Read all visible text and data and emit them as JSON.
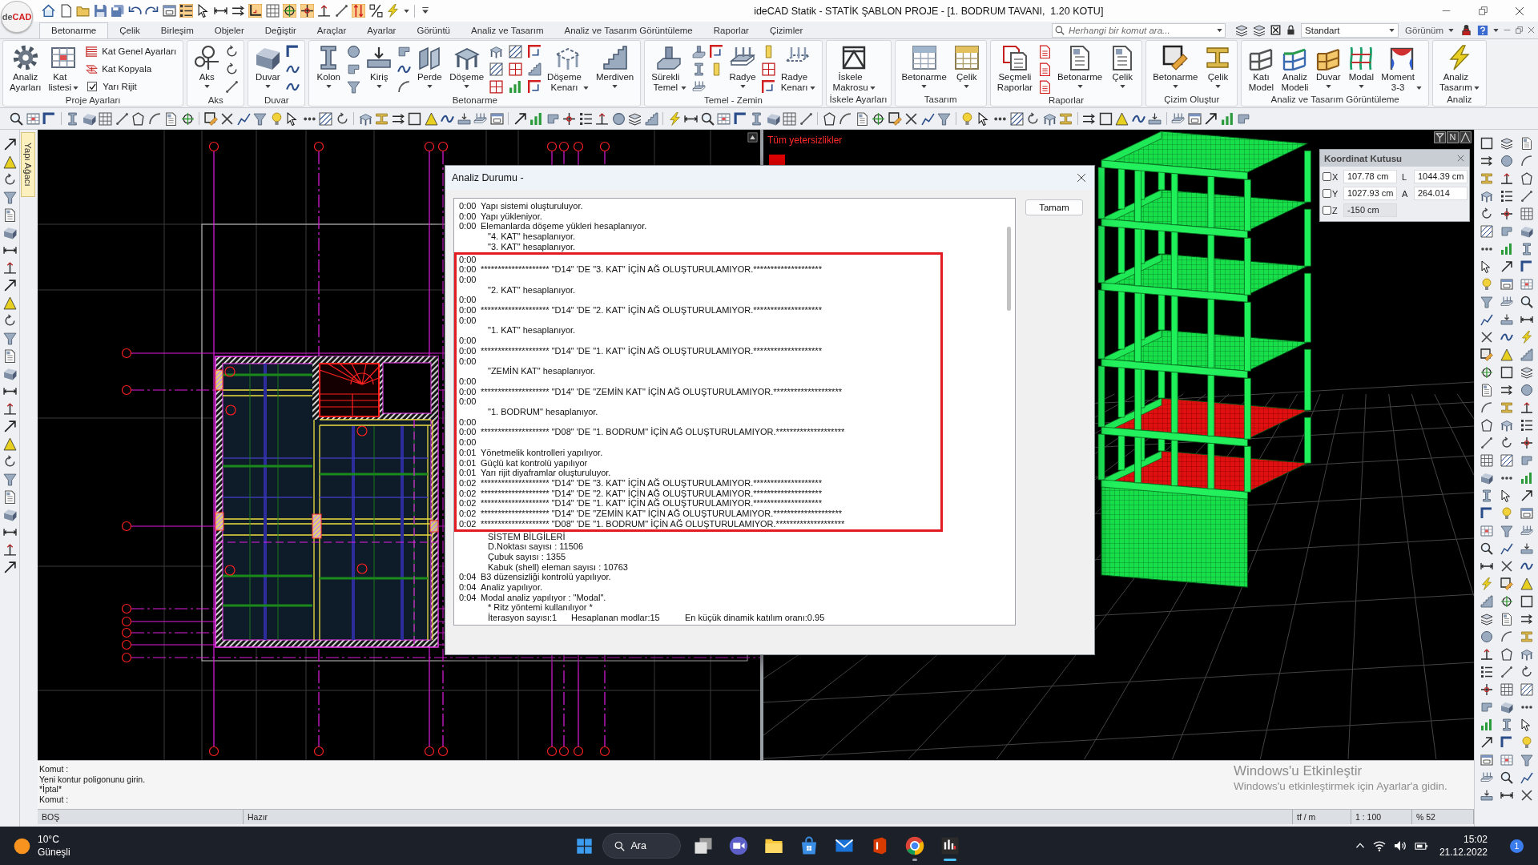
{
  "window": {
    "logo": "de**CAD**",
    "title": "ideCAD Statik - STATİK ŞABLON PROJE - [1. BODRUM TAVANI,  1.20 KOTU]"
  },
  "quick_access": [
    {
      "on": false
    },
    {
      "on": false
    },
    {
      "on": false
    },
    {
      "on": false
    },
    {
      "on": false
    },
    {
      "on": false
    },
    {
      "on": false
    },
    {
      "on": false
    },
    {
      "on": true
    },
    {
      "on": false
    },
    {
      "on": false
    },
    {
      "on": false
    },
    {
      "on": true
    },
    {
      "on": false
    },
    {
      "on": true
    },
    {
      "on": true
    },
    {
      "on": false
    },
    {
      "on": false
    },
    {
      "on": true
    },
    {
      "on": false
    },
    {
      "on": false
    }
  ],
  "tabs": [
    {
      "label": "Betonarme",
      "selected": true
    },
    {
      "label": "Çelik",
      "selected": false
    },
    {
      "label": "Birleşim",
      "selected": false
    },
    {
      "label": "Objeler",
      "selected": false
    },
    {
      "label": "Değiştir",
      "selected": false
    },
    {
      "label": "Araçlar",
      "selected": false
    },
    {
      "label": "Ayarlar",
      "selected": false
    },
    {
      "label": "Görüntü",
      "selected": false
    },
    {
      "label": "Analiz ve Tasarım",
      "selected": false
    },
    {
      "label": "Analiz ve Tasarım Görüntüleme",
      "selected": false
    },
    {
      "label": "Raporlar",
      "selected": false
    },
    {
      "label": "Çizimler",
      "selected": false
    }
  ],
  "search": {
    "placeholder": "Herhangi bir komut ara..."
  },
  "style_dropdown": {
    "value": "Standart"
  },
  "view_menu": {
    "label": "Görünüm"
  },
  "ribbon_groups": [
    {
      "label": "Proje Ayarları",
      "items": [
        {
          "kind": "large",
          "label": "Analiz Ayarları",
          "dropdown": false
        },
        {
          "kind": "large",
          "label": "Kat listesi",
          "dropdown": true
        },
        {
          "kind": "stack",
          "entries": [
            {
              "kind": "button",
              "label": "Kat Genel Ayarları"
            },
            {
              "kind": "button",
              "label": "Kat Kopyala"
            },
            {
              "kind": "checkbox",
              "label": "Yarı Rijit",
              "checked": true
            }
          ]
        }
      ]
    },
    {
      "label": "Aks",
      "items": [
        {
          "kind": "large",
          "label": "Aks",
          "dropdown": true
        },
        {
          "kind": "icons"
        }
      ]
    },
    {
      "label": "Duvar",
      "items": [
        {
          "kind": "large",
          "label": "Duvar",
          "dropdown": true
        },
        {
          "kind": "icons"
        }
      ]
    },
    {
      "label": "Betonarme",
      "items": [
        {
          "kind": "large",
          "label": "Kolon",
          "dropdown": true
        },
        {
          "kind": "icons"
        },
        {
          "kind": "large",
          "label": "Kiriş",
          "dropdown": true
        },
        {
          "kind": "icons"
        },
        {
          "kind": "large",
          "label": "Perde",
          "dropdown": true
        },
        {
          "kind": "large",
          "label": "Döşeme",
          "dropdown": true
        },
        {
          "kind": "icons"
        },
        {
          "kind": "large",
          "label": "Döşeme Kenarı",
          "dropdown": true
        },
        {
          "kind": "large",
          "label": "Merdiven",
          "dropdown": true
        }
      ]
    },
    {
      "label": "Temel - Zemin",
      "items": [
        {
          "kind": "large",
          "label": "Sürekli Temel",
          "dropdown": true
        },
        {
          "kind": "icons"
        },
        {
          "kind": "icons"
        },
        {
          "kind": "large",
          "label": "Radye",
          "dropdown": true
        },
        {
          "kind": "icons"
        },
        {
          "kind": "large",
          "label": "Radye Kenarı",
          "dropdown": true
        }
      ]
    },
    {
      "label": "İskele Ayarları",
      "items": [
        {
          "kind": "large",
          "label": "İskele Makrosu",
          "dropdown": true
        }
      ]
    },
    {
      "label": "Tasarım",
      "items": [
        {
          "kind": "large",
          "label": "Betonarme",
          "dropdown": true
        },
        {
          "kind": "large",
          "label": "Çelik",
          "dropdown": true
        }
      ]
    },
    {
      "label": "Raporlar",
      "items": [
        {
          "kind": "large",
          "label": "Seçmeli Raporlar",
          "dropdown": false
        },
        {
          "kind": "icons"
        },
        {
          "kind": "large",
          "label": "Betonarme",
          "dropdown": true
        },
        {
          "kind": "large",
          "label": "Çelik",
          "dropdown": true
        }
      ]
    },
    {
      "label": "Çizim Oluştur",
      "items": [
        {
          "kind": "large",
          "label": "Betonarme",
          "dropdown": true
        },
        {
          "kind": "large",
          "label": "Çelik",
          "dropdown": true
        }
      ]
    },
    {
      "label": "Analiz ve Tasarım Görüntüleme",
      "items": [
        {
          "kind": "large",
          "label": "Katı Model",
          "dropdown": false
        },
        {
          "kind": "large",
          "label": "Analiz Modeli",
          "dropdown": false
        },
        {
          "kind": "large",
          "label": "Duvar",
          "dropdown": true
        },
        {
          "kind": "large",
          "label": "Modal",
          "dropdown": true
        },
        {
          "kind": "large",
          "label": "Moment 3-3",
          "dropdown": true
        }
      ]
    },
    {
      "label": "Analiz",
      "items": [
        {
          "kind": "large",
          "label": "Analiz Tasarım",
          "dropdown": true
        }
      ]
    }
  ],
  "structure_tree_tab": {
    "label": "Yapı Ağacı"
  },
  "viewport_3d": {
    "message": "Tüm yetersizlikler",
    "view_label": "N"
  },
  "coordinate_box": {
    "title": "Koordinat Kutusu",
    "rows": [
      {
        "axis": "X",
        "checked": false,
        "value": "107.78 cm",
        "disabled": false,
        "second_label": "L",
        "second_value": "1044.39 cm"
      },
      {
        "axis": "Y",
        "checked": false,
        "value": "1027.93 cm",
        "disabled": false,
        "second_label": "A",
        "second_value": "264.014"
      },
      {
        "axis": "Z",
        "checked": false,
        "value": "-150 cm",
        "disabled": true
      }
    ]
  },
  "dialog": {
    "title": "Analiz Durumu -",
    "ok_button": "Tamam",
    "log": [
      {
        "time": "0:00",
        "text": "Yapı sistemi oluşturuluyor.",
        "highlighted": false
      },
      {
        "time": "0:00",
        "text": "Yapı yükleniyor.",
        "highlighted": false
      },
      {
        "time": "0:00",
        "text": "Elemanlarda döşeme yükleri hesaplanıyor.",
        "highlighted": false
      },
      {
        "text": "\"4. KAT\" hesaplanıyor.",
        "highlighted": false
      },
      {
        "text": "\"3. KAT\" hesaplanıyor.",
        "highlighted": false
      },
      {
        "time": "0:00",
        "highlighted": true
      },
      {
        "time": "0:00",
        "text": "******************** \"D14\" 'DE \"3. KAT\" İÇİN AĞ OLUŞTURULAMIYOR.********************",
        "highlighted": true
      },
      {
        "time": "0:00",
        "highlighted": true
      },
      {
        "text": "\"2. KAT\" hesaplanıyor.",
        "highlighted": true
      },
      {
        "time": "0:00",
        "highlighted": true
      },
      {
        "time": "0:00",
        "text": "******************** \"D14\" 'DE \"2. KAT\" İÇİN AĞ OLUŞTURULAMIYOR.********************",
        "highlighted": true
      },
      {
        "time": "0:00",
        "highlighted": true
      },
      {
        "text": "\"1. KAT\" hesaplanıyor.",
        "highlighted": true
      },
      {
        "time": "0:00",
        "highlighted": true
      },
      {
        "time": "0:00",
        "text": "******************** \"D14\" 'DE \"1. KAT\" İÇİN AĞ OLUŞTURULAMIYOR.********************",
        "highlighted": true
      },
      {
        "time": "0:00",
        "highlighted": true
      },
      {
        "text": "\"ZEMİN KAT\" hesaplanıyor.",
        "highlighted": true
      },
      {
        "time": "0:00",
        "highlighted": true
      },
      {
        "time": "0:00",
        "text": "******************** \"D14\" 'DE \"ZEMİN KAT\" İÇİN AĞ OLUŞTURULAMIYOR.********************",
        "highlighted": true
      },
      {
        "time": "0:00",
        "highlighted": true
      },
      {
        "text": "\"1. BODRUM\" hesaplanıyor.",
        "highlighted": true
      },
      {
        "time": "0:00",
        "highlighted": true
      },
      {
        "time": "0:00",
        "text": "******************** \"D08\" 'DE \"1. BODRUM\" İÇİN AĞ OLUŞTURULAMIYOR.********************",
        "highlighted": true
      },
      {
        "time": "0:00",
        "highlighted": true
      },
      {
        "time": "0:01",
        "text": "Yönetmelik kontrolleri yapılıyor.",
        "highlighted": true
      },
      {
        "time": "0:01",
        "text": "Güçlü kat kontrolü yapılıyor",
        "highlighted": true
      },
      {
        "time": "0:01",
        "text": "Yarı rijit diyaframlar oluşturuluyor.",
        "highlighted": true
      },
      {
        "time": "0:02",
        "text": "******************** \"D14\" 'DE \"3. KAT\" İÇİN AĞ OLUŞTURULAMIYOR.********************",
        "highlighted": true
      },
      {
        "time": "0:02",
        "text": "******************** \"D14\" 'DE \"2. KAT\" İÇİN AĞ OLUŞTURULAMIYOR.********************",
        "highlighted": true
      },
      {
        "time": "0:02",
        "text": "******************** \"D14\" 'DE \"1. KAT\" İÇİN AĞ OLUŞTURULAMIYOR.********************",
        "highlighted": true
      },
      {
        "time": "0:02",
        "text": "******************** \"D14\" 'DE \"ZEMİN KAT\" İÇİN AĞ OLUŞTURULAMIYOR.********************",
        "highlighted": true
      },
      {
        "time": "0:02",
        "text": "******************** \"D08\" 'DE \"1. BODRUM\" İÇİN AĞ OLUŞTURULAMIYOR.********************",
        "highlighted": true
      },
      {
        "text": "SİSTEM BİLGİLERİ",
        "highlighted": false
      },
      {
        "text": "D.Noktası sayısı : 11506",
        "highlighted": false
      },
      {
        "text": "Çubuk sayısı : 1355",
        "highlighted": false
      },
      {
        "text": "Kabuk (shell) eleman sayısı : 10763",
        "highlighted": false
      },
      {
        "time": "0:04",
        "text": "B3 düzensizliği kontrolü yapılıyor.",
        "highlighted": false
      },
      {
        "time": "0:04",
        "text": "Analiz yapılıyor.",
        "highlighted": false
      },
      {
        "time": "0:04",
        "text": "Modal analiz yapılıyor : \"Modal\".",
        "highlighted": false
      },
      {
        "text": "* Ritz yöntemi kullanılıyor *",
        "highlighted": false
      },
      {
        "columns": [
          "İterasyon sayısı:1",
          "Hesaplanan modlar:15",
          "En küçük dinamik katılım oranı:0.95"
        ],
        "highlighted": false
      }
    ]
  },
  "command_lines": [
    "Komut :",
    "Yeni kontur poligonunu girin.",
    "*İptal*",
    "Komut :"
  ],
  "activation_notice": {
    "title": "Windows'u Etkinleştir",
    "text": "Windows'u etkinleştirmek için Ayarlar'a gidin."
  },
  "status_bar": [
    "BOŞ",
    "Hazır",
    "tf / m",
    "1 : 100",
    "% 52"
  ],
  "taskbar": {
    "weather": {
      "temperature": "10°C",
      "condition": "Güneşli"
    },
    "search_label": "Ara",
    "apps": [
      {
        "running": false,
        "selected": false
      },
      {
        "running": false,
        "selected": false
      },
      {
        "running": false,
        "selected": false
      },
      {
        "running": false,
        "selected": false
      },
      {
        "running": false,
        "selected": false
      },
      {
        "running": false,
        "selected": false
      },
      {
        "running": true,
        "selected": false
      },
      {
        "running": true,
        "selected": true
      }
    ],
    "clock": {
      "time": "15:02",
      "date": "21.12.2022"
    },
    "notification_count": "1"
  }
}
